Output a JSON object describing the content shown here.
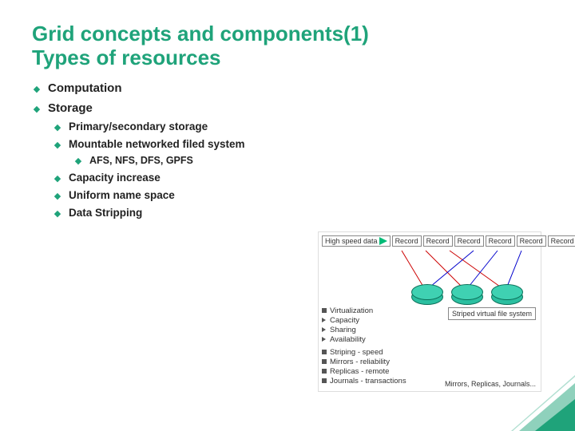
{
  "title_line1": "Grid concepts and components(1)",
  "title_line2": "Types of resources",
  "bullets": {
    "l1a": "Computation",
    "l1b": "Storage",
    "l2a": "Primary/secondary storage",
    "l2b": "Mountable networked filed system",
    "l3a": "AFS, NFS, DFS, GPFS",
    "l2c": "Capacity increase",
    "l2d": "Uniform name space",
    "l2e": "Data Stripping"
  },
  "diagram": {
    "hsd": "High speed data",
    "record": "Record",
    "features": {
      "virt": "Virtualization",
      "cap": "Capacity",
      "shar": "Sharing",
      "avail": "Availability",
      "stripe": "Striping - speed",
      "mirror": "Mirrors - reliability",
      "replica": "Replicas - remote",
      "journal": "Journals - transactions"
    },
    "svfs": "Striped virtual file system",
    "caption": "Mirrors, Replicas, Journals..."
  }
}
